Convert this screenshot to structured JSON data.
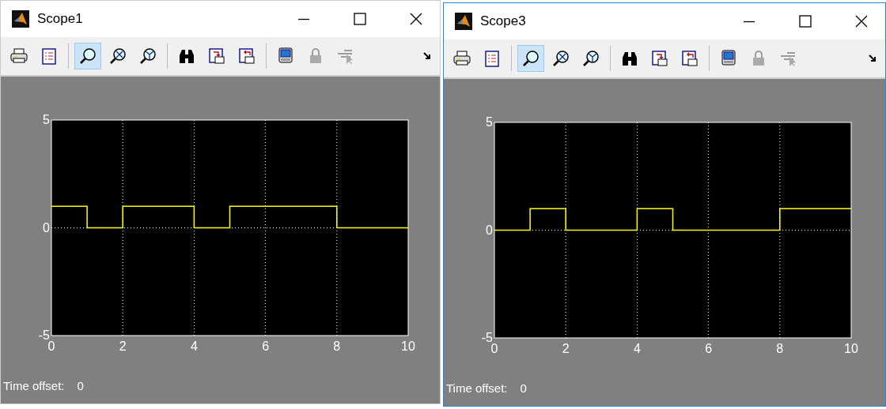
{
  "windows": [
    {
      "title": "Scope1",
      "active": false,
      "toolbar": [
        {
          "kind": "print",
          "selected": false,
          "disabled": false
        },
        {
          "kind": "parameters",
          "selected": false,
          "disabled": false
        },
        {
          "kind": "zoom",
          "selected": true,
          "disabled": false
        },
        {
          "kind": "zoom-x",
          "selected": false,
          "disabled": false
        },
        {
          "kind": "zoom-y",
          "selected": false,
          "disabled": false
        },
        {
          "kind": "autoscale",
          "selected": false,
          "disabled": false
        },
        {
          "kind": "save-axes",
          "selected": false,
          "disabled": false
        },
        {
          "kind": "restore-axes",
          "selected": false,
          "disabled": false
        },
        {
          "kind": "float",
          "selected": false,
          "disabled": false
        },
        {
          "kind": "lock",
          "selected": false,
          "disabled": true
        },
        {
          "kind": "signal-select",
          "selected": false,
          "disabled": true
        }
      ],
      "chart_data": {
        "type": "line",
        "x": [
          0,
          1,
          1,
          2,
          2,
          4,
          4,
          5,
          5,
          8,
          8,
          10
        ],
        "series": [
          {
            "color": "#ffff00",
            "values": [
              1,
              1,
              0,
              0,
              1,
              1,
              0,
              0,
              1,
              1,
              0,
              0
            ]
          }
        ],
        "xlim": [
          0,
          10
        ],
        "ylim": [
          -5,
          5
        ],
        "xticks": [
          0,
          2,
          4,
          6,
          8,
          10
        ],
        "yticks": [
          -5,
          0,
          5
        ],
        "grid": true
      },
      "time_offset": {
        "label": "Time offset:",
        "value": "0"
      }
    },
    {
      "title": "Scope3",
      "active": true,
      "toolbar": [
        {
          "kind": "print",
          "selected": false,
          "disabled": false
        },
        {
          "kind": "parameters",
          "selected": false,
          "disabled": false
        },
        {
          "kind": "zoom",
          "selected": true,
          "disabled": false
        },
        {
          "kind": "zoom-x",
          "selected": false,
          "disabled": false
        },
        {
          "kind": "zoom-y",
          "selected": false,
          "disabled": false
        },
        {
          "kind": "autoscale",
          "selected": false,
          "disabled": false
        },
        {
          "kind": "save-axes",
          "selected": false,
          "disabled": false
        },
        {
          "kind": "restore-axes",
          "selected": false,
          "disabled": false
        },
        {
          "kind": "float",
          "selected": false,
          "disabled": false
        },
        {
          "kind": "lock",
          "selected": false,
          "disabled": true
        },
        {
          "kind": "signal-select",
          "selected": false,
          "disabled": true
        }
      ],
      "chart_data": {
        "type": "line",
        "x": [
          0,
          1,
          1,
          2,
          2,
          4,
          4,
          5,
          5,
          8,
          8,
          10
        ],
        "series": [
          {
            "color": "#ffff00",
            "values": [
              0,
              0,
              1,
              1,
              0,
              0,
              1,
              1,
              0,
              0,
              1,
              1
            ]
          }
        ],
        "xlim": [
          0,
          10
        ],
        "ylim": [
          -5,
          5
        ],
        "xticks": [
          0,
          2,
          4,
          6,
          8,
          10
        ],
        "yticks": [
          -5,
          0,
          5
        ],
        "grid": true
      },
      "time_offset": {
        "label": "Time offset:",
        "value": "0"
      }
    }
  ]
}
